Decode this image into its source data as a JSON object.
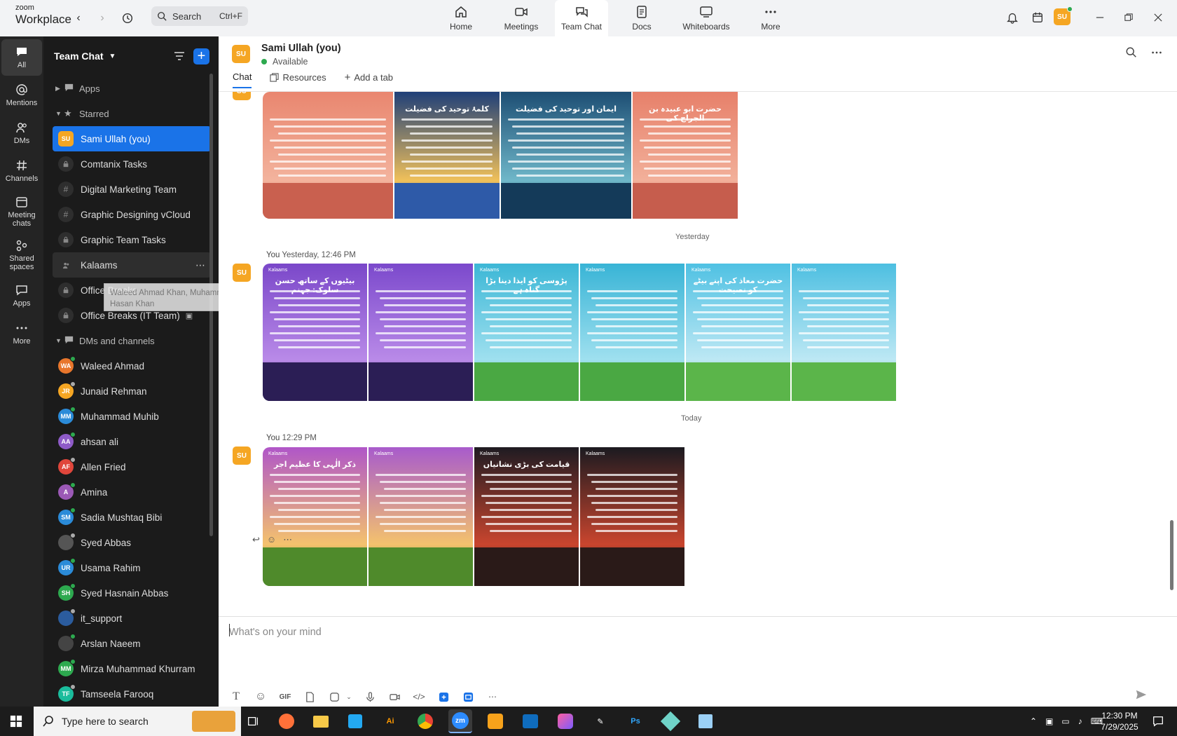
{
  "brand": {
    "line1": "zoom",
    "line2": "Workplace"
  },
  "search": {
    "placeholder": "Search",
    "shortcut": "Ctrl+F"
  },
  "top_tabs": [
    {
      "label": "Home",
      "icon": "home-icon"
    },
    {
      "label": "Meetings",
      "icon": "video-icon"
    },
    {
      "label": "Team Chat",
      "icon": "chat-icon"
    },
    {
      "label": "Docs",
      "icon": "doc-icon"
    },
    {
      "label": "Whiteboards",
      "icon": "whiteboard-icon"
    },
    {
      "label": "More",
      "icon": "more-icon"
    }
  ],
  "profile_initials": "SU",
  "rail": [
    {
      "label": "All"
    },
    {
      "label": "Mentions"
    },
    {
      "label": "DMs"
    },
    {
      "label": "Channels"
    },
    {
      "label": "Meeting chats"
    },
    {
      "label": "Shared spaces"
    },
    {
      "label": "Apps"
    },
    {
      "label": "More"
    }
  ],
  "sidebar": {
    "title": "Team Chat",
    "sections": {
      "apps": "Apps",
      "starred": "Starred",
      "dms": "DMs and channels"
    },
    "starred": [
      {
        "label": "Sami Ullah (you)",
        "initials": "SU",
        "color": "#f5a623"
      },
      {
        "label": "Comtanix Tasks",
        "icon": "lock"
      },
      {
        "label": "Digital Marketing Team",
        "icon": "hash"
      },
      {
        "label": "Graphic Designing vCloud",
        "icon": "hash"
      },
      {
        "label": "Graphic Team Tasks",
        "icon": "lock"
      },
      {
        "label": "Kalaams",
        "icon": "people"
      },
      {
        "label": "Office Breaks",
        "icon": "lock"
      },
      {
        "label": "Office Breaks (IT Team)",
        "icon": "lock"
      }
    ],
    "dms": [
      {
        "label": "Waleed Ahmad",
        "initials": "WA",
        "color": "#e8762c"
      },
      {
        "label": "Junaid Rehman",
        "initials": "JR",
        "color": "#f5a623"
      },
      {
        "label": "Muhammad Muhib",
        "initials": "MM",
        "color": "#2b8bd8"
      },
      {
        "label": "ahsan ali",
        "initials": "AA",
        "color": "#8e5bc7"
      },
      {
        "label": "Allen Fried",
        "initials": "AF",
        "color": "#e0463b"
      },
      {
        "label": "Amina",
        "initials": "A",
        "color": "#9b59b6"
      },
      {
        "label": "Sadia Mushtaq Bibi",
        "initials": "SM",
        "color": "#2b8bd8"
      },
      {
        "label": "Syed Abbas",
        "initials": "",
        "color": "#555555"
      },
      {
        "label": "Usama Rahim",
        "initials": "UR",
        "color": "#2b8bd8"
      },
      {
        "label": "Syed Hasnain Abbas",
        "initials": "SH",
        "color": "#2da94f"
      },
      {
        "label": "it_support",
        "initials": "",
        "color": "#2b5c9e"
      },
      {
        "label": "Arslan Naeem",
        "initials": "",
        "color": "#444444"
      },
      {
        "label": "Mirza Muhammad Khurram",
        "initials": "MM",
        "color": "#2da94f"
      },
      {
        "label": "Tamseela Farooq",
        "initials": "TF",
        "color": "#1abc9c"
      }
    ]
  },
  "tooltip": {
    "line1": "Waleed Ahmad Khan, Muhammad Muhib, ...",
    "line2": "Hasan Khan"
  },
  "chat": {
    "name": "Sami Ullah (you)",
    "initials": "SU",
    "status": "Available",
    "tabs": [
      "Chat",
      "Resources",
      "Add a tab"
    ],
    "day_yesterday": "Yesterday",
    "day_today": "Today",
    "msg1_sender": "You",
    "msg1_time": "Yesterday, 12:46 PM",
    "msg2_sender": "You",
    "msg2_time": "12:29 PM",
    "group0_titles": [
      "",
      "کلمۂ توحید کی فضیلت",
      "ایمان اور توحید کی فضیلت",
      "حضرت ابو عبیدہ بن الجراح کی"
    ],
    "group1_titles": [
      "بیٹیوں کے ساتھ حسن سلوک: جہنم",
      "",
      "پڑوسی کو ایذا دینا بڑا گناہ ہے",
      "",
      "حضرت معاذ کی اپنے بیٹے کو نصیحت",
      ""
    ],
    "group2_titles": [
      "ذکر الٰہی کا عظیم اجر",
      "",
      "قیامت کی بڑی نشانیاں",
      ""
    ],
    "tile_logo": "Kalaams",
    "compose_placeholder": "What's on your mind"
  },
  "taskbar": {
    "search_placeholder": "Type here to search",
    "time": "12:30 PM",
    "date": "7/29/2025"
  },
  "colors": {
    "accent": "#1a73e8",
    "available": "#2da94f",
    "avatar": "#f5a623"
  }
}
